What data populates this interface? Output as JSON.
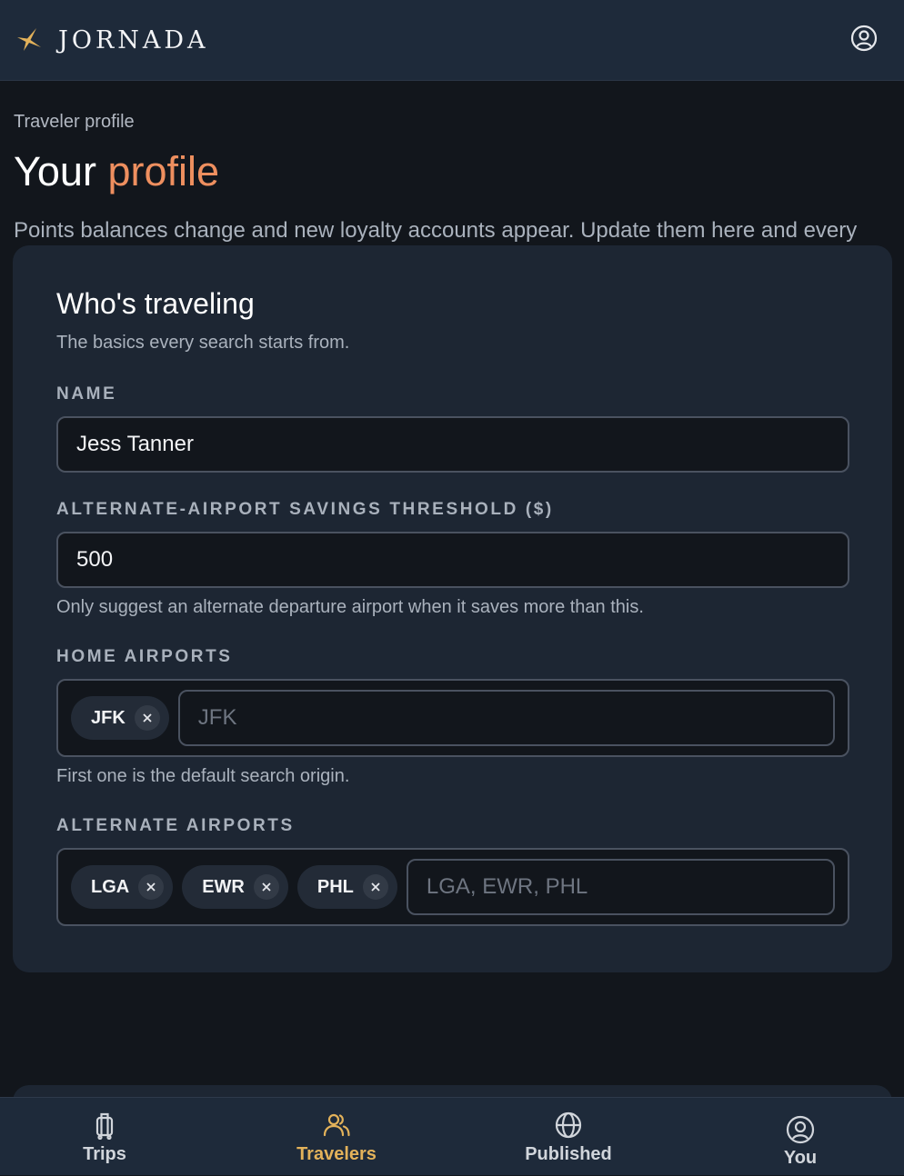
{
  "header": {
    "brand": "JORNADA",
    "logo_icon": "star-icon",
    "account_icon": "user-circle-icon"
  },
  "page": {
    "eyebrow": "Traveler profile",
    "title_plain": "Your ",
    "title_accent": "profile",
    "intro": "Points balances change and new loyalty accounts appear. Update them here and every trip picks up the change."
  },
  "card": {
    "title": "Who's traveling",
    "subtitle": "The basics every search starts from.",
    "name_label": "NAME",
    "name_value": "Jess Tanner",
    "threshold_label": "ALTERNATE-AIRPORT SAVINGS THRESHOLD ($)",
    "threshold_value": "500",
    "threshold_hint": "Only suggest an alternate departure airport when it saves more than this.",
    "home_label": "HOME AIRPORTS",
    "home_airports": [
      "JFK"
    ],
    "home_placeholder": "JFK",
    "home_hint": "First one is the default search origin.",
    "alt_label": "ALTERNATE AIRPORTS",
    "alt_airports": [
      "LGA",
      "EWR",
      "PHL"
    ],
    "alt_placeholder": "LGA, EWR, PHL"
  },
  "nav": {
    "items": [
      {
        "label": "Trips",
        "icon": "suitcase-icon",
        "active": false
      },
      {
        "label": "Travelers",
        "icon": "users-icon",
        "active": true
      },
      {
        "label": "Published",
        "icon": "globe-icon",
        "active": false
      },
      {
        "label": "You",
        "icon": "user-circle-icon",
        "active": false
      }
    ]
  },
  "colors": {
    "accent_orange": "#ee8f5f",
    "accent_gold": "#e3b25a",
    "header_bg": "#1e2a3a",
    "card_bg": "#1d2633",
    "page_bg": "#12161c"
  }
}
